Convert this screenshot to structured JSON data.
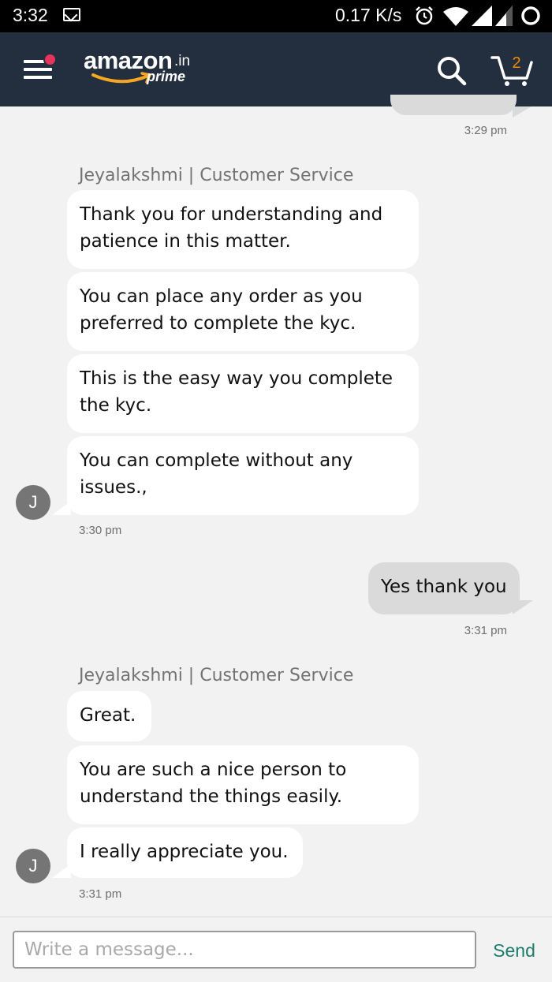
{
  "status_bar": {
    "time": "3:32",
    "network_speed": "0.17 K/s",
    "icons": [
      "gmail-icon",
      "alarm-icon",
      "wifi-icon",
      "signal-icon",
      "signal-icon",
      "circle-icon"
    ]
  },
  "header": {
    "logo_text": "amazon",
    "logo_suffix": ".in",
    "logo_sub": "prime",
    "cart_count": "2",
    "colors": {
      "background": "#232f3e",
      "notification_dot": "#e8335a",
      "cart_count": "#f08804"
    }
  },
  "chat": {
    "previous_timestamp": "3:29 pm",
    "agent_groups": [
      {
        "agent_name": "Jeyalakshmi | Customer Service",
        "messages": [
          "Thank you for understanding and patience  in this matter.",
          "You can place any order as you preferred to complete the kyc.",
          "This  is the easy way you complete the kyc.",
          "You can complete without any issues.,"
        ],
        "avatar_initial": "J",
        "timestamp": "3:30 pm"
      },
      {
        "agent_name": "Jeyalakshmi | Customer Service",
        "messages": [
          "Great.",
          "You are such a nice person to understand the things easily.",
          "I really appreciate you."
        ],
        "avatar_initial": "J",
        "timestamp": "3:31 pm"
      }
    ],
    "user_messages": [
      {
        "text": "Yes thank you",
        "timestamp": "3:31 pm"
      }
    ]
  },
  "composer": {
    "placeholder": "Write a message...",
    "value": "",
    "send_label": "Send",
    "send_color": "#1c7c6c"
  }
}
